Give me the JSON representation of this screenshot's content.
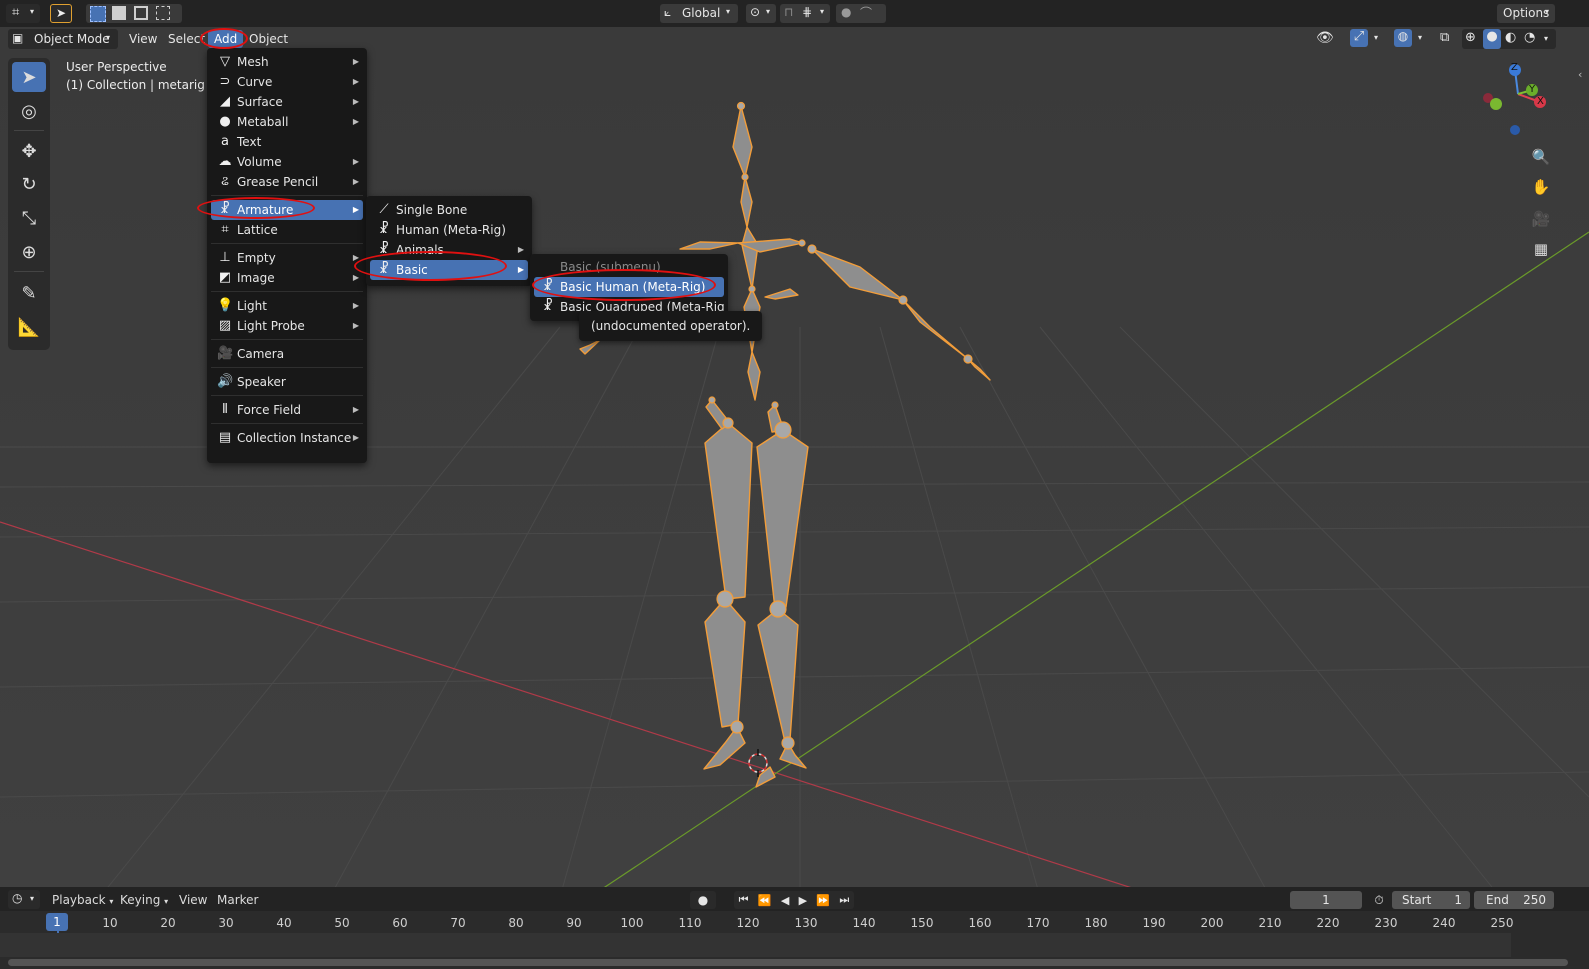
{
  "topbar": {
    "transform_orientation": "Global",
    "options_label": "Options"
  },
  "viewport_header": {
    "mode": "Object Mode",
    "menus": [
      "View",
      "Select",
      "Add",
      "Object"
    ]
  },
  "viewport_overlay": {
    "perspective": "User Perspective",
    "collection": "(1) Collection | metarig"
  },
  "gizmo": {
    "z": "Z",
    "y": "Y",
    "x": "X"
  },
  "add_menu": {
    "items": [
      {
        "label": "Mesh",
        "icon": "mesh-icon",
        "sub": true
      },
      {
        "label": "Curve",
        "icon": "curve-icon",
        "sub": true
      },
      {
        "label": "Surface",
        "icon": "surface-icon",
        "sub": true
      },
      {
        "label": "Metaball",
        "icon": "metaball-icon",
        "sub": true
      },
      {
        "label": "Text",
        "icon": "text-icon",
        "sub": false
      },
      {
        "label": "Volume",
        "icon": "volume-icon",
        "sub": true
      },
      {
        "label": "Grease Pencil",
        "icon": "grease-pencil-icon",
        "sub": true
      },
      {
        "label": "Armature",
        "icon": "armature-icon",
        "sub": true
      },
      {
        "label": "Lattice",
        "icon": "lattice-icon",
        "sub": false
      },
      {
        "label": "Empty",
        "icon": "empty-icon",
        "sub": true
      },
      {
        "label": "Image",
        "icon": "image-icon",
        "sub": true
      },
      {
        "label": "Light",
        "icon": "light-icon",
        "sub": true
      },
      {
        "label": "Light Probe",
        "icon": "light-probe-icon",
        "sub": true
      },
      {
        "label": "Camera",
        "icon": "camera-icon",
        "sub": false
      },
      {
        "label": "Speaker",
        "icon": "speaker-icon",
        "sub": false
      },
      {
        "label": "Force Field",
        "icon": "force-field-icon",
        "sub": true
      },
      {
        "label": "Collection Instance",
        "icon": "collection-instance-icon",
        "sub": true
      }
    ]
  },
  "armature_menu": {
    "items": [
      {
        "label": "Single Bone",
        "icon": "bone-icon"
      },
      {
        "label": "Human (Meta-Rig)",
        "icon": "armature-icon"
      },
      {
        "label": "Animals",
        "icon": "armature-icon"
      },
      {
        "label": "Basic",
        "icon": "armature-icon"
      }
    ]
  },
  "basic_menu": {
    "title": "Basic (submenu)",
    "items": [
      {
        "label": "Basic Human (Meta-Rig)",
        "icon": "armature-icon"
      },
      {
        "label": "Basic Quadruped (Meta-Rig)",
        "icon": "armature-icon"
      }
    ]
  },
  "tooltip": "(undocumented operator).",
  "timeline": {
    "menus": [
      "Playback",
      "Keying",
      "View",
      "Marker"
    ],
    "current_frame": "1",
    "start_label": "Start",
    "start_value": "1",
    "end_label": "End",
    "end_value": "250",
    "ruler": [
      "10",
      "20",
      "30",
      "40",
      "50",
      "60",
      "70",
      "80",
      "90",
      "100",
      "110",
      "120",
      "130",
      "140",
      "150",
      "160",
      "170",
      "180",
      "190",
      "200",
      "210",
      "220",
      "230",
      "240",
      "250"
    ],
    "ruler_current": "1"
  },
  "colors": {
    "accent": "#4772b3",
    "annotation": "#e01010",
    "bone_outline": "#f29d3a",
    "x_axis": "#b03a48",
    "y_axis": "#6a9a2a"
  }
}
